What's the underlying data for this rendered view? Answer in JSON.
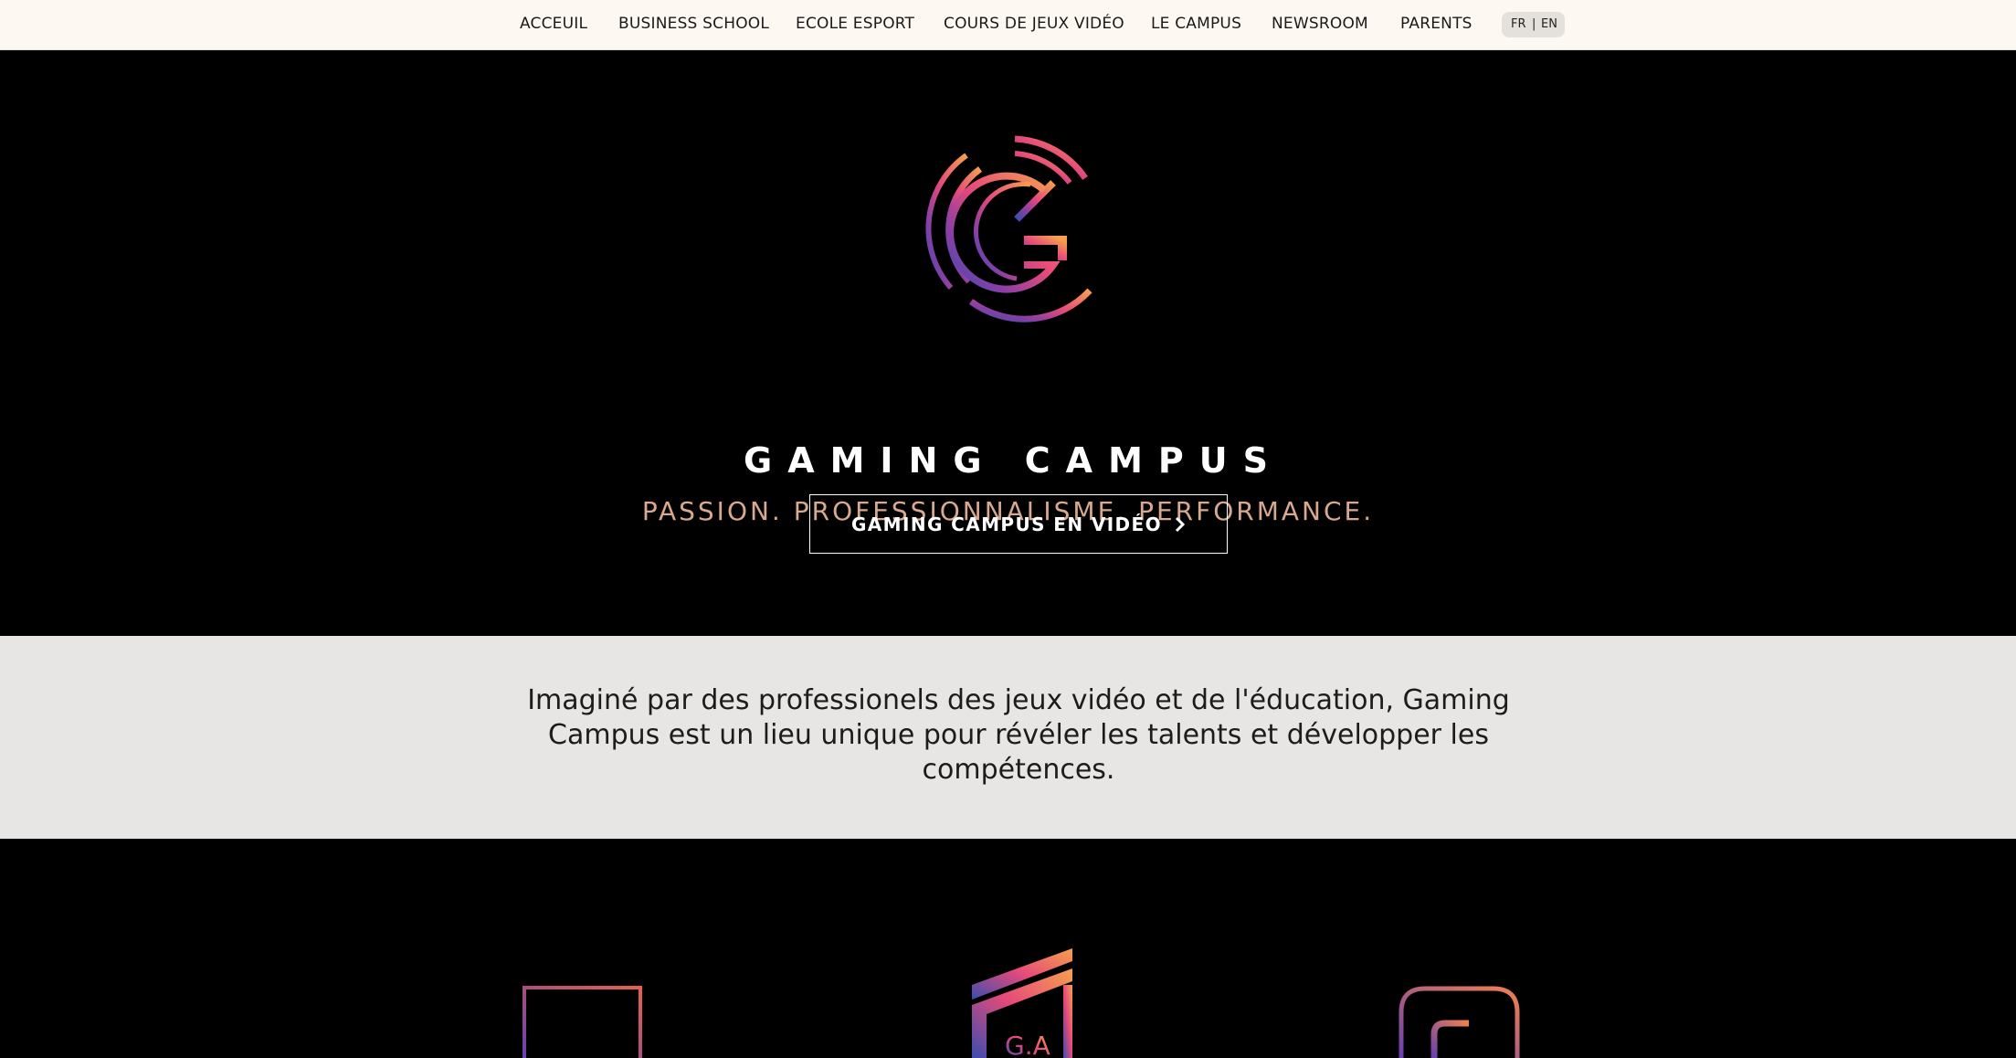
{
  "nav": {
    "items": [
      {
        "label": "ACCEUIL"
      },
      {
        "label": "BUSINESS SCHOOL"
      },
      {
        "label": "ECOLE ESPORT"
      },
      {
        "label": "COURS DE JEUX VIDÉO"
      },
      {
        "label": "LE CAMPUS"
      },
      {
        "label": "NEWSROOM"
      },
      {
        "label": "PARENTS"
      }
    ],
    "lang": {
      "fr": "FR",
      "sep": "|",
      "en": "EN"
    }
  },
  "hero": {
    "logo_icon": "gaming-campus-logo",
    "title": "GAMING CAMPUS",
    "subtitle": "PASSION. PROFESSIONNALISME. PERFORMANCE.",
    "cta_label": "GAMING CAMPUS EN VIDÉO",
    "cta_icon": "chevron-right-icon"
  },
  "intro": {
    "text": "Imaginé par des professionels des jeux vidéo et de l'éducation, Gaming Campus est un lieu unique pour révéler les talents et développer les compétences."
  },
  "colors": {
    "nav_bg": "#fdf8f1",
    "gradient_orange": "#f6a04d",
    "gradient_pink": "#e64a7a",
    "gradient_purple": "#8a3fa5",
    "gradient_blue": "#3a4db0"
  },
  "school_logos": [
    "school-logo-square-icon",
    "school-logo-ga-icon",
    "school-logo-gl-icon"
  ]
}
